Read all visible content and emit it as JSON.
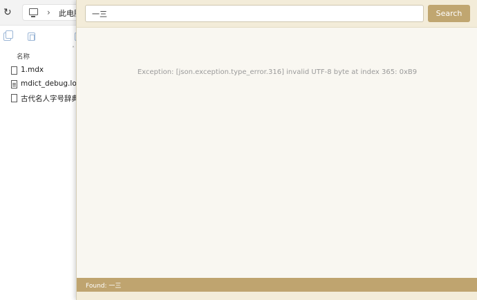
{
  "explorer": {
    "breadcrumb": "此电脑",
    "column_header": "名称",
    "files": [
      {
        "name": "1.mdx",
        "icon": "file-icon"
      },
      {
        "name": "mdict_debug.log",
        "icon": "log-file-icon"
      },
      {
        "name": "古代名人字号辞典.mdx",
        "icon": "file-icon"
      }
    ]
  },
  "dictionary": {
    "search_value": "一三",
    "search_button": "Search",
    "error_message": "Exception: [json.exception.type_error.316] invalid UTF-8 byte at index 365: 0xB9",
    "status": "Found: 一三"
  },
  "colors": {
    "accent": "#c0a670",
    "status_bar": "#bfa46f",
    "header_bg": "#f3ecd9",
    "content_bg": "#f9f7f1"
  }
}
